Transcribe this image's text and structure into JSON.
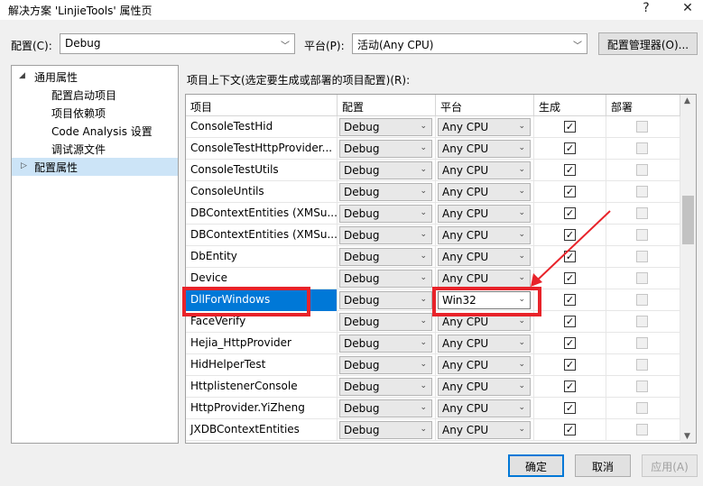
{
  "window": {
    "title": "解决方案 'LinjieTools' 属性页",
    "help": "?",
    "close": "✕"
  },
  "config": {
    "label": "配置(C):",
    "value": "Debug"
  },
  "platform": {
    "label": "平台(P):",
    "value": "活动(Any CPU)"
  },
  "config_manager_label": "配置管理器(O)...",
  "tree": [
    {
      "label": "通用属性",
      "expander": "◢",
      "level": 0
    },
    {
      "label": "配置启动项目",
      "level": 1
    },
    {
      "label": "项目依赖项",
      "level": 1
    },
    {
      "label": "Code Analysis 设置",
      "level": 1
    },
    {
      "label": "调试源文件",
      "level": 1
    },
    {
      "label": "配置属性",
      "expander": "▷",
      "level": 0,
      "selected": true
    }
  ],
  "context_label": "项目上下文(选定要生成或部署的项目配置)(R):",
  "columns": {
    "project": "项目",
    "config": "配置",
    "platform": "平台",
    "build": "生成",
    "deploy": "部署"
  },
  "rows": [
    {
      "name": "ConsoleTestHid",
      "config": "Debug",
      "platform": "Any CPU",
      "build": true,
      "deploy": false
    },
    {
      "name": "ConsoleTestHttpProvider...",
      "config": "Debug",
      "platform": "Any CPU",
      "build": true,
      "deploy": false
    },
    {
      "name": "ConsoleTestUtils",
      "config": "Debug",
      "platform": "Any CPU",
      "build": true,
      "deploy": false
    },
    {
      "name": "ConsoleUntils",
      "config": "Debug",
      "platform": "Any CPU",
      "build": true,
      "deploy": false
    },
    {
      "name": "DBContextEntities (XMSu...",
      "config": "Debug",
      "platform": "Any CPU",
      "build": true,
      "deploy": false
    },
    {
      "name": "DBContextEntities (XMSu...",
      "config": "Debug",
      "platform": "Any CPU",
      "build": true,
      "deploy": false
    },
    {
      "name": "DbEntity",
      "config": "Debug",
      "platform": "Any CPU",
      "build": true,
      "deploy": false
    },
    {
      "name": "Device",
      "config": "Debug",
      "platform": "Any CPU",
      "build": true,
      "deploy": false
    },
    {
      "name": "DllForWindows",
      "config": "Debug",
      "platform": "Win32",
      "build": true,
      "deploy": false,
      "selected": true
    },
    {
      "name": "FaceVerify",
      "config": "Debug",
      "platform": "Any CPU",
      "build": true,
      "deploy": false
    },
    {
      "name": "Hejia_HttpProvider",
      "config": "Debug",
      "platform": "Any CPU",
      "build": true,
      "deploy": false
    },
    {
      "name": "HidHelperTest",
      "config": "Debug",
      "platform": "Any CPU",
      "build": true,
      "deploy": false
    },
    {
      "name": "HttplistenerConsole",
      "config": "Debug",
      "platform": "Any CPU",
      "build": true,
      "deploy": false
    },
    {
      "name": "HttpProvider.YiZheng",
      "config": "Debug",
      "platform": "Any CPU",
      "build": true,
      "deploy": false
    },
    {
      "name": "JXDBContextEntities",
      "config": "Debug",
      "platform": "Any CPU",
      "build": true,
      "deploy": false
    }
  ],
  "buttons": {
    "ok": "确定",
    "cancel": "取消",
    "apply": "应用(A)"
  },
  "icons": {
    "dropdown": "chevron-down-icon",
    "check": "✓",
    "scroll_up": "▲",
    "scroll_down": "▼"
  },
  "colors": {
    "selection": "#0078d7",
    "annotation": "#e8232a"
  }
}
